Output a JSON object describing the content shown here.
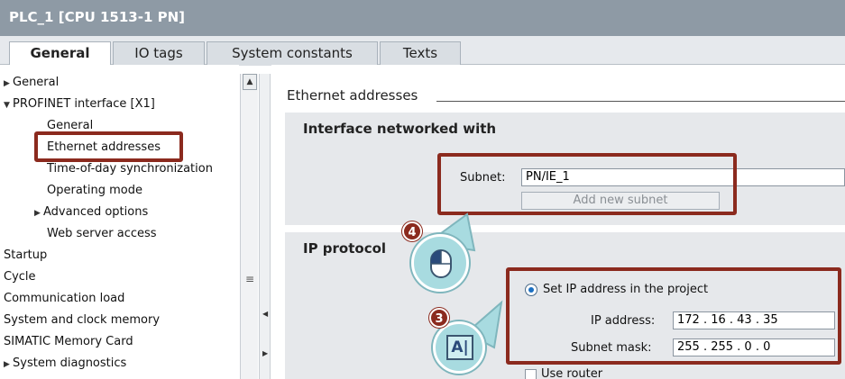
{
  "window": {
    "title": "PLC_1 [CPU 1513-1 PN]"
  },
  "tabs": [
    {
      "label": "General",
      "active": true
    },
    {
      "label": "IO tags",
      "active": false
    },
    {
      "label": "System constants",
      "active": false
    },
    {
      "label": "Texts",
      "active": false
    }
  ],
  "tree": [
    {
      "label": "General",
      "caret": "▶"
    },
    {
      "label": "PROFINET interface [X1]",
      "caret": "▼"
    },
    {
      "label": "General",
      "caret": ""
    },
    {
      "label": "Ethernet addresses",
      "caret": ""
    },
    {
      "label": "Time-of-day synchronization",
      "caret": ""
    },
    {
      "label": "Operating mode",
      "caret": ""
    },
    {
      "label": "Advanced options",
      "caret": "▶"
    },
    {
      "label": "Web server access",
      "caret": ""
    },
    {
      "label": "Startup",
      "caret": ""
    },
    {
      "label": "Cycle",
      "caret": ""
    },
    {
      "label": "Communication load",
      "caret": ""
    },
    {
      "label": "System and clock memory",
      "caret": ""
    },
    {
      "label": "SIMATIC Memory Card",
      "caret": ""
    },
    {
      "label": "System diagnostics",
      "caret": "▶"
    }
  ],
  "content": {
    "section_title": "Ethernet addresses",
    "interface": {
      "title": "Interface networked with",
      "subnet_label": "Subnet:",
      "subnet_value": "PN/IE_1",
      "add_subnet": "Add new subnet"
    },
    "ip": {
      "title": "IP protocol",
      "set_ip_label": "Set IP address in the project",
      "ip_label": "IP address:",
      "ip_value": "172 . 16  . 43  . 35",
      "mask_label": "Subnet mask:",
      "mask_value": "255 . 255 . 0   . 0",
      "router_label": "Use router"
    }
  },
  "callouts": {
    "step3": "3",
    "step4": "4",
    "text_cursor_icon": "A|"
  },
  "colors": {
    "highlight": "#8b2a1e",
    "titlebar": "#8e9aa5",
    "bubble": "#a8dbe0"
  }
}
